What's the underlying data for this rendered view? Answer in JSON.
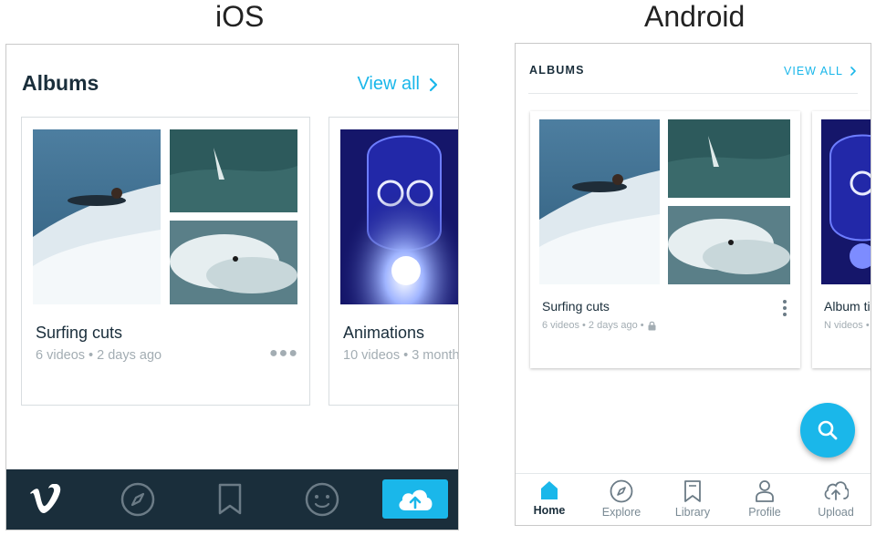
{
  "headings": {
    "ios": "iOS",
    "android": "Android"
  },
  "ios": {
    "section_title": "Albums",
    "view_all": "View all",
    "albums": [
      {
        "title": "Surfing cuts",
        "meta": "6 videos • 2 days ago"
      },
      {
        "title": "Animations",
        "meta": "10 videos • 3 month"
      }
    ],
    "tabs": [
      "vimeo-logo",
      "explore",
      "library",
      "profile",
      "upload"
    ]
  },
  "android": {
    "section_title": "ALBUMS",
    "view_all": "VIEW ALL",
    "albums": [
      {
        "title": "Surfing cuts",
        "meta": "6 videos • 2 days ago •"
      },
      {
        "title": "Album ti",
        "meta": "N videos •"
      }
    ],
    "nav": [
      {
        "label": "Home"
      },
      {
        "label": "Explore"
      },
      {
        "label": "Library"
      },
      {
        "label": "Profile"
      },
      {
        "label": "Upload"
      }
    ]
  },
  "colors": {
    "accent": "#1ab7ea",
    "dark": "#1a2e3b",
    "muted": "#a3adb3"
  }
}
